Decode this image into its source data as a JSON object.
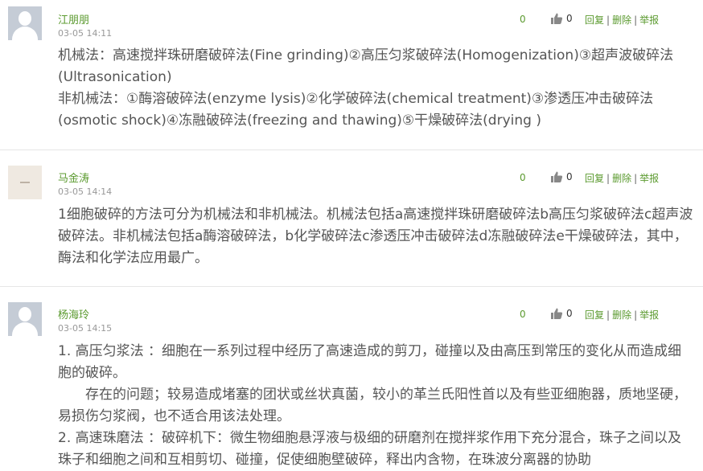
{
  "comments": [
    {
      "username": "江朋朋",
      "time": "03-05 14:11",
      "count": "0",
      "likes": "0",
      "actions": {
        "reply": "回复",
        "delete": "删除",
        "report": "举报"
      },
      "lines": [
        "机械法：高速搅拌珠研磨破碎法(Fine grinding)②高压匀浆破碎法(Homogenization)③超声波破碎法(Ultrasonication)",
        "非机械法：①酶溶破碎法(enzyme lysis)②化学破碎法(chemical treatment)③渗透压冲击破碎法(osmotic shock)④冻融破碎法(freezing and thawing)⑤干燥破碎法(drying )"
      ]
    },
    {
      "username": "马金涛",
      "time": "03-05 14:14",
      "count": "0",
      "likes": "0",
      "actions": {
        "reply": "回复",
        "delete": "删除",
        "report": "举报"
      },
      "lines": [
        "1细胞破碎的方法可分为机械法和非机械法。机械法包括a高速搅拌珠研磨破碎法b高压匀浆破碎法c超声波破碎法。非机械法包括a酶溶破碎法，b化学破碎法c渗透压冲击破碎法d冻融破碎法e干燥破碎法，其中，酶法和化学法应用最广。"
      ]
    },
    {
      "username": "杨海玲",
      "time": "03-05 14:15",
      "count": "0",
      "likes": "0",
      "actions": {
        "reply": "回复",
        "delete": "删除",
        "report": "举报"
      },
      "lines": [
        "1. 高压匀浆法 ：细胞在一系列过程中经历了高速造成的剪刀，碰撞以及由高压到常压的变化从而造成细胞的破碎。",
        "存在的问题；较易造成堵塞的团状或丝状真菌，较小的革兰氏阳性首以及有些亚细胞器，质地坚硬，易损伤匀浆阀，也不适合用该法处理。",
        "2. 高速珠磨法 ：破碎机下：微生物细胞悬浮液与极细的研磨剂在搅拌浆作用下充分混合，珠子之间以及珠子和细胞之间和互相剪切、碰撞，促使细胞壁破碎，释出内含物，在珠波分离器的协助"
      ]
    }
  ],
  "colors": {
    "accent": "#5b9a2f",
    "text": "#555555",
    "muted": "#999999"
  },
  "icons": {
    "avatar": "default-user-avatar",
    "like": "thumbs-up-icon"
  }
}
